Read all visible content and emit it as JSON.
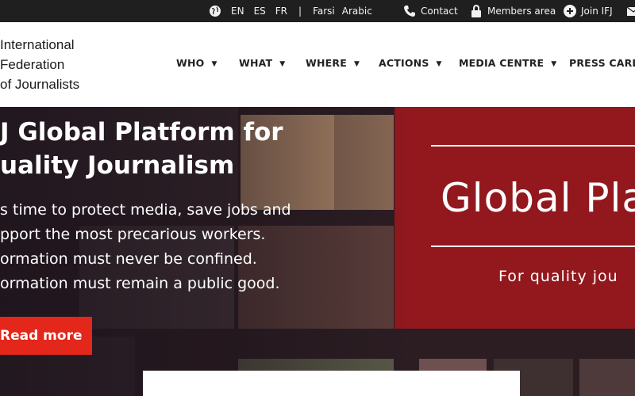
{
  "topbar": {
    "languages": [
      "EN",
      "ES",
      "FR"
    ],
    "separator": "|",
    "extra_languages": [
      "Farsi",
      "Arabic"
    ],
    "contact_label": "Contact",
    "members_label": "Members area",
    "join_label": "Join IFJ"
  },
  "logo": {
    "line1": "International",
    "line2": "Federation",
    "line3": "of Journalists"
  },
  "nav": [
    {
      "label": "WHO"
    },
    {
      "label": "WHAT"
    },
    {
      "label": "WHERE"
    },
    {
      "label": "ACTIONS"
    },
    {
      "label": "MEDIA CENTRE"
    },
    {
      "label": "PRESS CARD"
    }
  ],
  "hero": {
    "title_line1": "J Global Platform for",
    "title_line2": "uality Journalism",
    "text_lines": [
      "s time to protect media, save jobs and",
      "pport the most precarious workers.",
      "ormation must never be confined.",
      "ormation must remain a public good."
    ],
    "read_more": "Read more",
    "banner_title": "Global Pla",
    "banner_subtitle": "For quality jou"
  },
  "colors": {
    "topbar_bg": "#1f1f1f",
    "accent_red": "#e3271b",
    "banner_red": "#a0181e"
  }
}
